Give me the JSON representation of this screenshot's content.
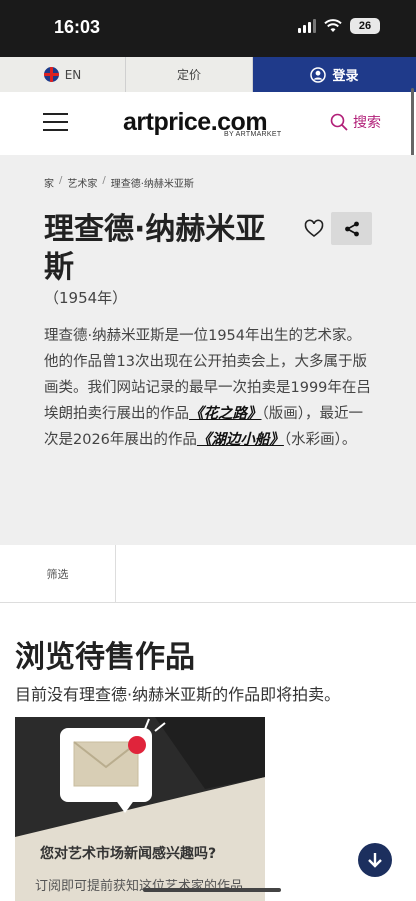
{
  "status_bar": {
    "time": "16:03",
    "battery": "26"
  },
  "topbar": {
    "lang": "EN",
    "price": "定价",
    "login": "登录"
  },
  "header": {
    "logo": "artprice.com",
    "logo_sub": "BY ARTMARKET",
    "search": "搜索"
  },
  "breadcrumb": {
    "home": "家",
    "sep": "/",
    "artists": "艺术家",
    "current": "理查德·纳赫米亚斯"
  },
  "artist": {
    "name": "理查德·纳赫米亚斯",
    "years": "（1954年）",
    "bio_part1": "理查德·纳赫米亚斯是一位1954年出生的艺术家。他的作品曾13次出现在公开拍卖会上，大多属于版画类。我们网站记录的最早一次拍卖是1999年在吕埃朗拍卖行展出的作品",
    "bio_link1": "《花之路》",
    "bio_part2": "（版画），最近一次是2026年展出的作品",
    "bio_link2": "《湖边小船》",
    "bio_part3": "（水彩画）。"
  },
  "filter": {
    "label": "筛选"
  },
  "browse": {
    "title": "浏览待售作品",
    "subtitle": "目前没有理查德·纳赫米亚斯的作品即将拍卖。"
  },
  "newsletter": {
    "title": "您对艺术市场新闻感兴趣吗?",
    "text": "订阅即可提前获知这位艺术家的作品"
  },
  "colors": {
    "login_bg": "#1f3a8a",
    "search_accent": "#b11f78",
    "notification_dot": "#e0243b",
    "fab_bg": "#1c2f5e"
  },
  "icons": [
    "uk-flag-icon",
    "user-icon",
    "menu-icon",
    "search-icon",
    "heart-icon",
    "share-icon",
    "envelope-icon",
    "arrow-down-icon",
    "wifi-icon",
    "signal-icon"
  ]
}
